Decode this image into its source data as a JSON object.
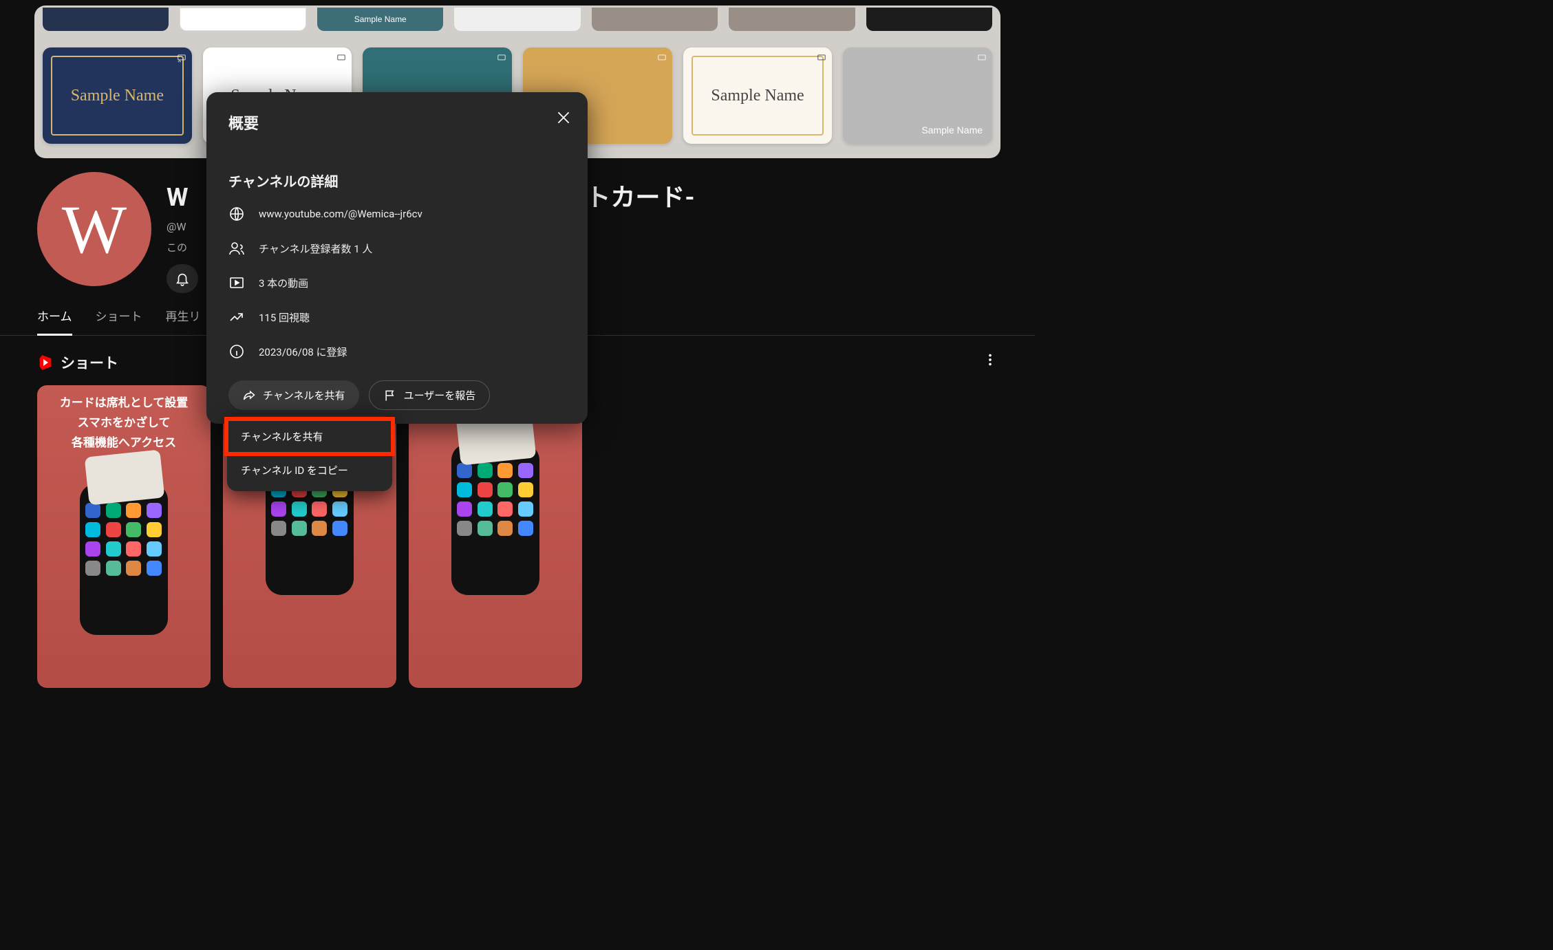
{
  "banner": {
    "sample_label": "Sample Name",
    "sample_label_alt": "Sample Name"
  },
  "channel": {
    "title_fragment_left": "W",
    "title_fragment_right": "トカード-",
    "handle_fragment": "@W",
    "desc_fragment": "この",
    "avatar_letter": "W"
  },
  "tabs": {
    "home": "ホーム",
    "shorts": "ショート",
    "playlists": "再生リ"
  },
  "shorts": {
    "heading": "ショート",
    "card_line1": "カードは席札として設置",
    "card_line2": "スマホをかざして",
    "card_line3": "各種機能へアクセス"
  },
  "modal": {
    "title": "概要",
    "sub": "チャンネルの詳細",
    "url": "www.youtube.com/@Wemica--jr6cv",
    "subs": "チャンネル登録者数 1 人",
    "videos": "3 本の動画",
    "views": "115 回視聴",
    "joined": "2023/06/08 に登録",
    "share": "チャンネルを共有",
    "report": "ユーザーを報告"
  },
  "share_menu": {
    "share": "チャンネルを共有",
    "copy_id": "チャンネル ID をコピー"
  }
}
